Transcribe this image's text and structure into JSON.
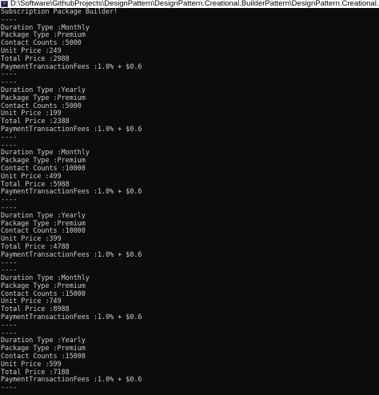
{
  "window": {
    "title": "D:\\Software\\GithubProjects\\DesignPattern\\DesignPattern.Creational.BuilderPattern\\DesignPattern.Creational.BuilderPattern.ConsoleApp\\bin\\",
    "icon": "console-app-icon"
  },
  "console": {
    "lines": [
      "Subscription Package Builder!",
      "----",
      "Duration Type :Monthly",
      "Package Type :Premium",
      "Contact Counts :5000",
      "Unit Price :249",
      "Total Price :2988",
      "PaymentTransactionFees :1.0% + $0.6",
      "----",
      "----",
      "Duration Type :Yearly",
      "Package Type :Premium",
      "Contact Counts :5000",
      "Unit Price :199",
      "Total Price :2388",
      "PaymentTransactionFees :1.0% + $0.6",
      "----",
      "----",
      "Duration Type :Monthly",
      "Package Type :Premium",
      "Contact Counts :10000",
      "Unit Price :499",
      "Total Price :5988",
      "PaymentTransactionFees :1.0% + $0.6",
      "----",
      "----",
      "Duration Type :Yearly",
      "Package Type :Premium",
      "Contact Counts :10000",
      "Unit Price :399",
      "Total Price :4788",
      "PaymentTransactionFees :1.0% + $0.6",
      "----",
      "----",
      "Duration Type :Monthly",
      "Package Type :Premium",
      "Contact Counts :15000",
      "Unit Price :749",
      "Total Price :8988",
      "PaymentTransactionFees :1.0% + $0.6",
      "----",
      "----",
      "Duration Type :Yearly",
      "Package Type :Premium",
      "Contact Counts :15000",
      "Unit Price :599",
      "Total Price :7188",
      "PaymentTransactionFees :1.0% + $0.6",
      "----"
    ]
  }
}
